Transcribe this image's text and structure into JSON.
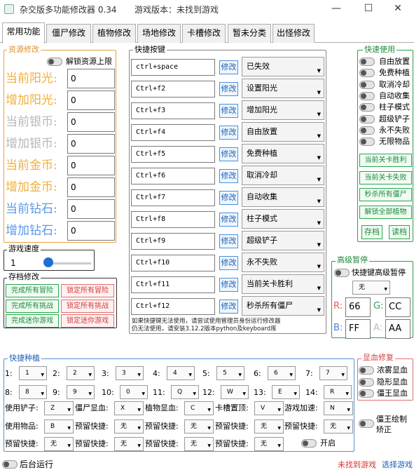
{
  "window": {
    "title": "杂交版多功能修改器 0.34",
    "version_label": "游戏版本：未找到游戏",
    "minimize": "—",
    "maximize": "☐",
    "close": "✕"
  },
  "tabs": [
    "常用功能",
    "僵尸修改",
    "植物修改",
    "场地修改",
    "卡槽修改",
    "暂未分类",
    "出怪修改"
  ],
  "resources": {
    "legend": "资源修改",
    "unlock_label": "解锁资源上限",
    "rows": [
      {
        "label": "当前阳光:",
        "value": "0",
        "color": "#f0b040"
      },
      {
        "label": "增加阳光:",
        "value": "0",
        "color": "#f0b040"
      },
      {
        "label": "当前银币:",
        "value": "0",
        "color": "#b8b8b8"
      },
      {
        "label": "增加银币:",
        "value": "0",
        "color": "#b8b8b8"
      },
      {
        "label": "当前金币:",
        "value": "0",
        "color": "#f0b040"
      },
      {
        "label": "增加金币:",
        "value": "0",
        "color": "#f0b040"
      },
      {
        "label": "当前钻石:",
        "value": "0",
        "color": "#5a9ae6"
      },
      {
        "label": "增加钻石:",
        "value": "0",
        "color": "#5a9ae6"
      }
    ]
  },
  "speed": {
    "legend": "游戏速度",
    "value": "1",
    "level": 0
  },
  "save": {
    "legend": "存档修改",
    "buttons": [
      {
        "label": "完成所有冒险",
        "kind": "green"
      },
      {
        "label": "锁定所有冒险",
        "kind": "red"
      },
      {
        "label": "完成所有挑战",
        "kind": "green"
      },
      {
        "label": "锁定所有挑战",
        "kind": "red"
      },
      {
        "label": "完成迷你游戏",
        "kind": "green"
      },
      {
        "label": "锁定迷你游戏",
        "kind": "red"
      }
    ]
  },
  "hotkeys": {
    "legend": "快捷按键",
    "modify_label": "修改",
    "rows": [
      {
        "key": "ctrl+space",
        "action": "已失效"
      },
      {
        "key": "Ctrl+f2",
        "action": "设置阳光"
      },
      {
        "key": "Ctrl+f3",
        "action": "增加阳光"
      },
      {
        "key": "Ctrl+f4",
        "action": "自由放置"
      },
      {
        "key": "Ctrl+f5",
        "action": "免费种植"
      },
      {
        "key": "Ctrl+f6",
        "action": "取消冷却"
      },
      {
        "key": "Ctrl+f7",
        "action": "自动收集"
      },
      {
        "key": "Ctrl+f8",
        "action": "柱子模式"
      },
      {
        "key": "Ctrl+f9",
        "action": "超级铲子"
      },
      {
        "key": "Ctrl+f10",
        "action": "永不失败"
      },
      {
        "key": "Ctrl+f11",
        "action": "当前关卡胜利"
      },
      {
        "key": "Ctrl+f12",
        "action": "秒杀所有僵尸"
      }
    ],
    "note_line1": "如果快捷键无法使用，请尝试使用管理员身份运行修改器",
    "note_line2": "仍无法使用，请安装3.12.2版本python及keyboard库"
  },
  "quick_use": {
    "legend": "快速使用",
    "toggles": [
      "自由放置",
      "免费种植",
      "取消冷却",
      "自动收集",
      "柱子模式",
      "超级铲子",
      "永不失败",
      "无限物品"
    ],
    "buttons": [
      "当前关卡胜利",
      "当前关卡失败",
      "秒杀所有僵尸",
      "解锁全部植物"
    ],
    "save_label": "存档",
    "load_label": "读档"
  },
  "advanced_pause": {
    "legend": "高级暂停",
    "hotkey_label": "快捷键高级暂停",
    "key_value": "无",
    "r_label": "R:",
    "r_value": "66",
    "g_label": "G:",
    "g_value": "CC",
    "b_label": "B:",
    "b_value": "FF",
    "a_label": "A:",
    "a_value": "AA"
  },
  "quick_plant": {
    "legend": "快捷种植",
    "slots": [
      {
        "num": "1:",
        "key": "1"
      },
      {
        "num": "2:",
        "key": "2"
      },
      {
        "num": "3:",
        "key": "3"
      },
      {
        "num": "4:",
        "key": "4"
      },
      {
        "num": "5:",
        "key": "5"
      },
      {
        "num": "6:",
        "key": "6"
      },
      {
        "num": "7:",
        "key": "7"
      },
      {
        "num": "8:",
        "key": "8"
      },
      {
        "num": "9:",
        "key": "9"
      },
      {
        "num": "10:",
        "key": "0"
      },
      {
        "num": "11:",
        "key": "Q"
      },
      {
        "num": "12:",
        "key": "W"
      },
      {
        "num": "13:",
        "key": "E"
      },
      {
        "num": "14:",
        "key": "R"
      }
    ],
    "row3": [
      {
        "label": "使用铲子:",
        "key": "Z"
      },
      {
        "label": "僵尸显血:",
        "key": "X"
      },
      {
        "label": "植物显血:",
        "key": "C"
      },
      {
        "label": "卡槽置顶:",
        "key": "V"
      },
      {
        "label": "游戏加速:",
        "key": "N"
      }
    ],
    "row4": [
      {
        "label": "使用物品:",
        "key": "B"
      },
      {
        "label": "预留快捷:",
        "key": "无"
      },
      {
        "label": "预留快捷:",
        "key": "无"
      },
      {
        "label": "预留快捷:",
        "key": "无"
      },
      {
        "label": "预留快捷:",
        "key": "无"
      }
    ],
    "row5": [
      {
        "label": "预留快捷:",
        "key": "无"
      },
      {
        "label": "预留快捷:",
        "key": "无"
      },
      {
        "label": "预留快捷:",
        "key": "无"
      },
      {
        "label": "预留快捷:",
        "key": "无"
      }
    ],
    "enable_label": "开启"
  },
  "blood": {
    "legend": "显血修复",
    "toggles": [
      "浓雾显血",
      "隐形显血",
      "僵王显血"
    ],
    "boss_draw_label1": "僵王绘制",
    "boss_draw_label2": "矫正"
  },
  "footer": {
    "background_run_label": "后台运行",
    "status": "未找到游戏",
    "select_game": "选择游戏"
  },
  "colors": {
    "green": "#1c8a3a",
    "red": "#d34040",
    "blue": "#1860b8",
    "orange": "#f0a030",
    "status_red": "#e0302a"
  }
}
